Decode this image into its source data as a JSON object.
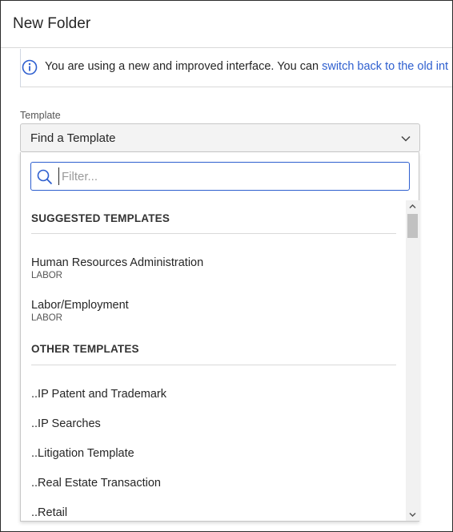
{
  "dialog": {
    "title": "New Folder"
  },
  "banner": {
    "icon": "info-icon",
    "text": "You are using a new and improved interface. You can ",
    "link_text": "switch back to the old int",
    "link_color": "#2e5fcf"
  },
  "template_field": {
    "label": "Template",
    "selected_value": "Find a Template",
    "chevron_icon": "chevron-down-icon"
  },
  "dropdown": {
    "filter": {
      "placeholder": "Filter...",
      "value": "",
      "icon": "search-icon",
      "border_color": "#2e5fcf"
    },
    "suggested": {
      "heading": "SUGGESTED TEMPLATES",
      "items": [
        {
          "name": "Human Resources Administration",
          "category": "LABOR"
        },
        {
          "name": "Labor/Employment",
          "category": "LABOR"
        }
      ]
    },
    "other": {
      "heading": "OTHER TEMPLATES",
      "items": [
        {
          "name": "..IP Patent and Trademark"
        },
        {
          "name": "..IP Searches"
        },
        {
          "name": "..Litigation Template"
        },
        {
          "name": "..Real Estate Transaction"
        },
        {
          "name": "..Retail"
        }
      ]
    }
  }
}
